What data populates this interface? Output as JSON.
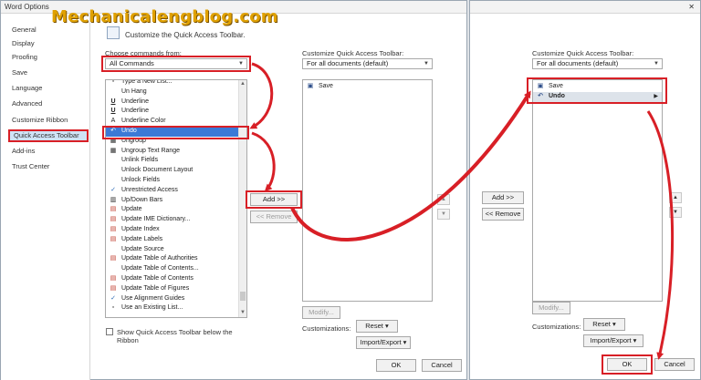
{
  "watermark": "Mechanicalengblog.com",
  "left_window": {
    "title": "Word Options",
    "sidebar": [
      {
        "label": "General",
        "active": false
      },
      {
        "label": "Display",
        "active": false
      },
      {
        "label": "Proofing",
        "active": false
      },
      {
        "label": "Save",
        "active": false
      },
      {
        "label": "Language",
        "active": false
      },
      {
        "label": "Advanced",
        "active": false
      },
      {
        "label": "Customize Ribbon",
        "active": false
      },
      {
        "label": "Quick Access Toolbar",
        "active": true
      },
      {
        "label": "Add-ins",
        "active": false
      },
      {
        "label": "Trust Center",
        "active": false
      }
    ],
    "header": "Customize the Quick Access Toolbar.",
    "choose_label": "Choose commands from:",
    "choose_value": "All Commands",
    "commands": [
      {
        "label": "Type a New List...",
        "icon": "doc-icon",
        "glyph": "▫"
      },
      {
        "label": "Un Hang",
        "icon": "blank-icon",
        "glyph": ""
      },
      {
        "label": "Underline",
        "icon": "underline-icon",
        "glyph": "U"
      },
      {
        "label": "Underline",
        "icon": "underline-icon",
        "glyph": "U",
        "more": "▶"
      },
      {
        "label": "Underline Color",
        "icon": "underline-color-icon",
        "glyph": "A",
        "more": "▶"
      },
      {
        "label": "Undo",
        "icon": "undo-icon",
        "glyph": "↶",
        "selected": true,
        "more": "▶"
      },
      {
        "label": "Ungroup",
        "icon": "ungroup-icon",
        "glyph": "▦"
      },
      {
        "label": "Ungroup Text Range",
        "icon": "ungroup-icon",
        "glyph": "▦"
      },
      {
        "label": "Unlink Fields",
        "icon": "blank-icon",
        "glyph": ""
      },
      {
        "label": "Unlock Document Layout",
        "icon": "blank-icon",
        "glyph": ""
      },
      {
        "label": "Unlock Fields",
        "icon": "blank-icon",
        "glyph": ""
      },
      {
        "label": "Unrestricted Access",
        "icon": "check-icon",
        "glyph": "✓"
      },
      {
        "label": "Up/Down Bars",
        "icon": "bars-icon",
        "glyph": "▥",
        "more": "▶"
      },
      {
        "label": "Update",
        "icon": "update-icon",
        "glyph": "▤"
      },
      {
        "label": "Update IME Dictionary...",
        "icon": "update-icon",
        "glyph": "▤"
      },
      {
        "label": "Update Index",
        "icon": "update-icon",
        "glyph": "▤"
      },
      {
        "label": "Update Labels",
        "icon": "update-icon",
        "glyph": "▤"
      },
      {
        "label": "Update Source",
        "icon": "blank-icon",
        "glyph": ""
      },
      {
        "label": "Update Table of Authorities",
        "icon": "update-icon",
        "glyph": "▤"
      },
      {
        "label": "Update Table of Contents...",
        "icon": "blank-icon",
        "glyph": ""
      },
      {
        "label": "Update Table of Contents",
        "icon": "update-icon",
        "glyph": "▤"
      },
      {
        "label": "Update Table of Figures",
        "icon": "update-icon",
        "glyph": "▤"
      },
      {
        "label": "Use Alignment Guides",
        "icon": "check-icon",
        "glyph": "✓"
      },
      {
        "label": "Use an Existing List...",
        "icon": "doc-icon",
        "glyph": "▫"
      }
    ],
    "add_button": "Add >>",
    "remove_button": "<< Remove",
    "show_below_label_line1": "Show Quick Access Toolbar below the",
    "show_below_label_line2": "Ribbon",
    "customize_label": "Customize Quick Access Toolbar:",
    "customize_value": "For all documents (default)",
    "toolbar_items": [
      {
        "label": "Save",
        "icon": "save-icon",
        "glyph": "▣"
      }
    ],
    "modify_button": "Modify...",
    "customizations_label": "Customizations:",
    "reset_button": "Reset ▾",
    "import_export_button": "Import/Export ▾",
    "ok_button": "OK",
    "cancel_button": "Cancel"
  },
  "right_window": {
    "customize_label": "Customize Quick Access Toolbar:",
    "customize_value": "For all documents (default)",
    "toolbar_items": [
      {
        "label": "Save",
        "icon": "save-icon",
        "glyph": "▣",
        "selected": false
      },
      {
        "label": "Undo",
        "icon": "undo-icon",
        "glyph": "↶",
        "selected": true,
        "more": "▶"
      }
    ],
    "add_button": "Add >>",
    "remove_button": "<< Remove",
    "modify_button": "Modify...",
    "customizations_label": "Customizations:",
    "reset_button": "Reset ▾",
    "import_export_button": "Import/Export ▾",
    "ok_button": "OK",
    "cancel_button": "Cancel",
    "close_glyph": "✕"
  },
  "colors": {
    "highlight_red": "#d81f26",
    "selection_blue": "#3b79d6",
    "watermark_gold": "#e0a100"
  }
}
